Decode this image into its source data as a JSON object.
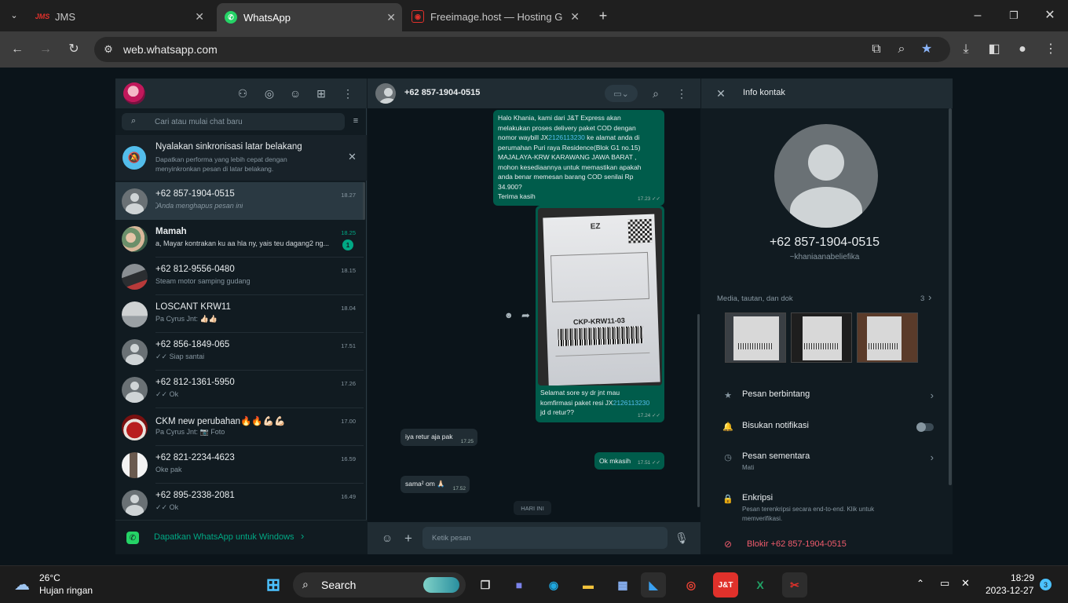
{
  "browser": {
    "tabs": [
      {
        "title": "JMS",
        "favicon": "JMS"
      },
      {
        "title": "WhatsApp"
      },
      {
        "title": "Freeimage.host — Hosting Gam"
      }
    ],
    "url": "web.whatsapp.com"
  },
  "sidebar": {
    "search_placeholder": "Cari atau mulai chat baru",
    "notice": {
      "title": "Nyalakan sinkronisasi latar belakang",
      "text1": "Dapatkan performa yang lebih cepat dengan",
      "text2": "menyinkronkan pesan di latar belakang."
    },
    "chats": [
      {
        "name": "+62 857-1904-0515",
        "preview": "⃠ Anda menghapus pesan ini",
        "time": "18.27"
      },
      {
        "name": "Mamah",
        "preview": "a, Mayar kontrakan ku aa hla ny, yais teu dagang2 ng...",
        "time": "18.25",
        "unread": "1"
      },
      {
        "name": "+62 812-9556-0480",
        "preview": "Steam motor samping gudang",
        "time": "18.15"
      },
      {
        "name": "LOSCANT KRW11",
        "preview": "Pa Cyrus Jnt: 👍🏻👍🏻",
        "time": "18.04"
      },
      {
        "name": "+62 856-1849-065",
        "preview": "✓✓ Siap santai",
        "time": "17.51"
      },
      {
        "name": "+62 812-1361-5950",
        "preview": "✓✓ Ok",
        "time": "17.26"
      },
      {
        "name": "CKM new perubahan🔥🔥💪🏻💪🏻",
        "preview": "Pa Cyrus Jnt: 📷 Foto",
        "time": "17.00"
      },
      {
        "name": "+62 821-2234-4623",
        "preview": "Oke pak",
        "time": "16.59"
      },
      {
        "name": "+62 895-2338-2081",
        "preview": "✓✓ Ok",
        "time": "16.49"
      }
    ],
    "get_windows": "Dapatkan WhatsApp untuk Windows",
    "get_windows_chev": "›"
  },
  "chat": {
    "contact": "+62 857-1904-0515",
    "msg1": {
      "l1": "Halo Khania, kami dari J&T Express akan",
      "l2": "melakukan proses delivery paket COD dengan",
      "l3a": "nomor waybill JX",
      "l3b": "2126113230",
      "l3c": " ke alamat anda di",
      "l4": "perumahan Puri raya Residence(Blok G1 no.15)",
      "l5": "MAJALAYA-KRW KARAWANG JAWA BARAT ,",
      "l6": "mohon kesediaannya untuk memastikan apakah",
      "l7": "anda benar memesan barang COD senilai Rp",
      "l8": "34.900?",
      "l9": "Terima kasih",
      "time": "17.23 ✓✓"
    },
    "img_msg": {
      "label_ez": "EZ",
      "label_code": "CKP-KRW11-03",
      "l1": "Selamat sore sy dr jnt mau",
      "l2a": "komfirmasi paket resi JX",
      "l2b": "2126113230",
      "l3": "jd d retur??",
      "time": "17.24 ✓✓"
    },
    "in1": {
      "text": "iya retur aja pak",
      "time": "17.25"
    },
    "out2": {
      "text": "Ok mkasih",
      "time": "17.51 ✓✓"
    },
    "in2": {
      "text": "sama² om 🙏🏻",
      "time": "17.52"
    },
    "day_divider": "HARI INI",
    "input_placeholder": "Ketik pesan"
  },
  "info": {
    "title": "Info kontak",
    "phone": "+62 857-1904-0515",
    "nickname": "~khaniaanabeliefika",
    "media_label": "Media, tautan, dan dok",
    "media_count": "3",
    "starred": "Pesan berbintang",
    "mute": "Bisukan notifikasi",
    "disappearing": "Pesan sementara",
    "disappearing_sub": "Mati",
    "encryption": "Enkripsi",
    "encryption_sub1": "Pesan terenkripsi secara end-to-end. Klik untuk",
    "encryption_sub2": "memverifikasi.",
    "block": "Blokir +62 857-1904-0515"
  },
  "taskbar": {
    "weather_temp": "26°C",
    "weather_desc": "Hujan ringan",
    "search": "Search",
    "time": "18:29",
    "date": "2023-12-27",
    "notif_count": "3"
  },
  "colors": {
    "accent": "#00a884",
    "outgoing": "#005c4b",
    "link": "#53bdeb",
    "danger": "#f15c6d"
  }
}
